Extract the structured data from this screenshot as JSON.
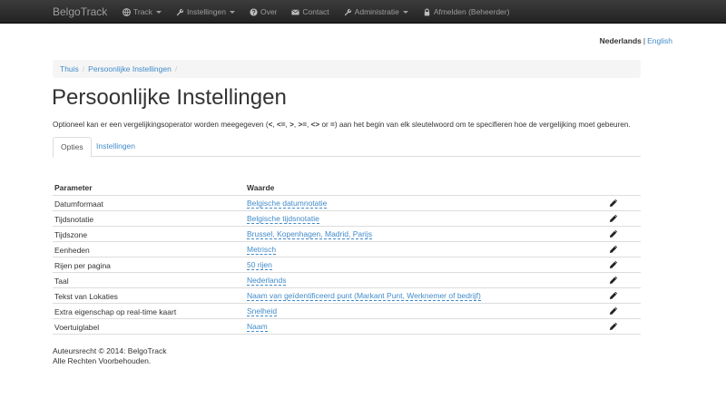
{
  "navbar": {
    "brand": "BelgoTrack",
    "items": [
      {
        "label": "Track",
        "icon": "globe-icon",
        "dropdown": true
      },
      {
        "label": "Instellingen",
        "icon": "wrench-icon",
        "dropdown": true
      },
      {
        "label": "Over",
        "icon": "question-circle-icon",
        "dropdown": false
      },
      {
        "label": "Contact",
        "icon": "envelope-icon",
        "dropdown": false
      },
      {
        "label": "Administratie",
        "icon": "wrench-icon",
        "dropdown": true
      },
      {
        "label": "Afmelden (Beheerder)",
        "icon": "lock-icon",
        "dropdown": false
      }
    ]
  },
  "language": {
    "current": "Nederlands",
    "separator": "|",
    "other": "English"
  },
  "breadcrumb": [
    {
      "label": "Thuis"
    },
    {
      "label": "Persoonlijke Instellingen"
    }
  ],
  "page": {
    "title": "Persoonlijke Instellingen",
    "intro_before": "Optioneel kan er een vergelijkingsoperator worden meegegeven (",
    "intro_ops": [
      "<",
      "<=",
      ">",
      ">=",
      "<>",
      "="
    ],
    "intro_after": ") aan het begin van elk sleutelwoord om te specifieren hoe de vergelijking moet gebeuren.",
    "tabs": [
      {
        "label": "Opties",
        "active": true
      },
      {
        "label": "Instellingen",
        "active": false
      }
    ]
  },
  "table": {
    "headers": {
      "parameter": "Parameter",
      "value": "Waarde"
    },
    "rows": [
      {
        "parameter": "Datumformaat",
        "value": "Belgische datumnotatie"
      },
      {
        "parameter": "Tijdsnotatie",
        "value": "Belgische tijdsnotatie"
      },
      {
        "parameter": "Tijdszone",
        "value": "Brussel, Kopenhagen, Madrid, Parijs"
      },
      {
        "parameter": "Eenheden",
        "value": "Metrisch"
      },
      {
        "parameter": "Rijen per pagina",
        "value": "50 rijen"
      },
      {
        "parameter": "Taal",
        "value": "Nederlands"
      },
      {
        "parameter": "Tekst van Lokaties",
        "value": "Naam van geïdentificeerd punt (Markant Punt, Werknemer of bedrijf)"
      },
      {
        "parameter": "Extra eigenschap op real-time kaart",
        "value": "Snelheid"
      },
      {
        "parameter": "Voertuiglabel",
        "value": "Naam"
      }
    ]
  },
  "footer": {
    "line1": "Auteursrecht © 2014: BelgoTrack",
    "line2": "Alle Rechten Voorbehouden."
  },
  "colors": {
    "navbar": "#222222",
    "link": "#428bca",
    "text": "#333333"
  }
}
